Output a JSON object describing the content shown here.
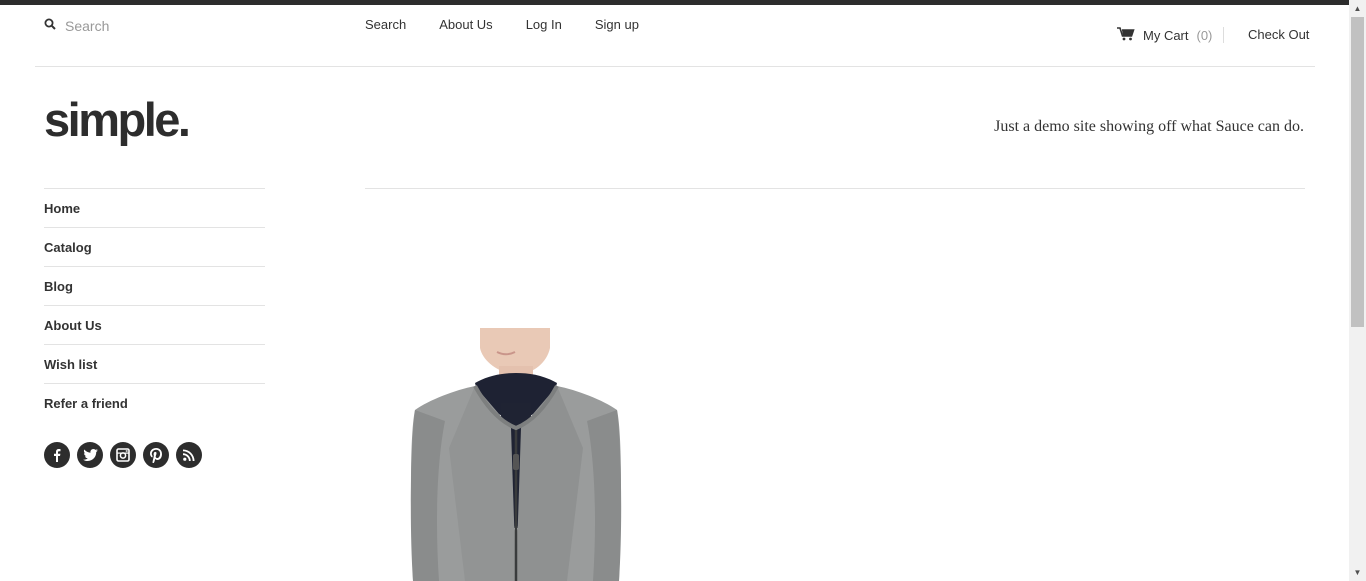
{
  "header": {
    "search_placeholder": "Search",
    "nav": [
      {
        "label": "Search"
      },
      {
        "label": "About Us"
      },
      {
        "label": "Log In"
      },
      {
        "label": "Sign up"
      }
    ],
    "cart_label": "My Cart",
    "cart_count": "(0)",
    "checkout_label": "Check Out"
  },
  "brand": {
    "logo": "simple.",
    "tagline": "Just a demo site showing off what Sauce can do."
  },
  "sidebar": {
    "items": [
      {
        "label": "Home"
      },
      {
        "label": "Catalog"
      },
      {
        "label": "Blog"
      },
      {
        "label": "About Us"
      },
      {
        "label": "Wish list"
      },
      {
        "label": "Refer a friend"
      }
    ],
    "social": [
      "facebook-icon",
      "twitter-icon",
      "instagram-icon",
      "pinterest-icon",
      "rss-icon"
    ]
  },
  "colors": {
    "dark": "#2d2d2d",
    "text": "#333333",
    "muted": "#999999",
    "divider": "#e3e3e3"
  }
}
